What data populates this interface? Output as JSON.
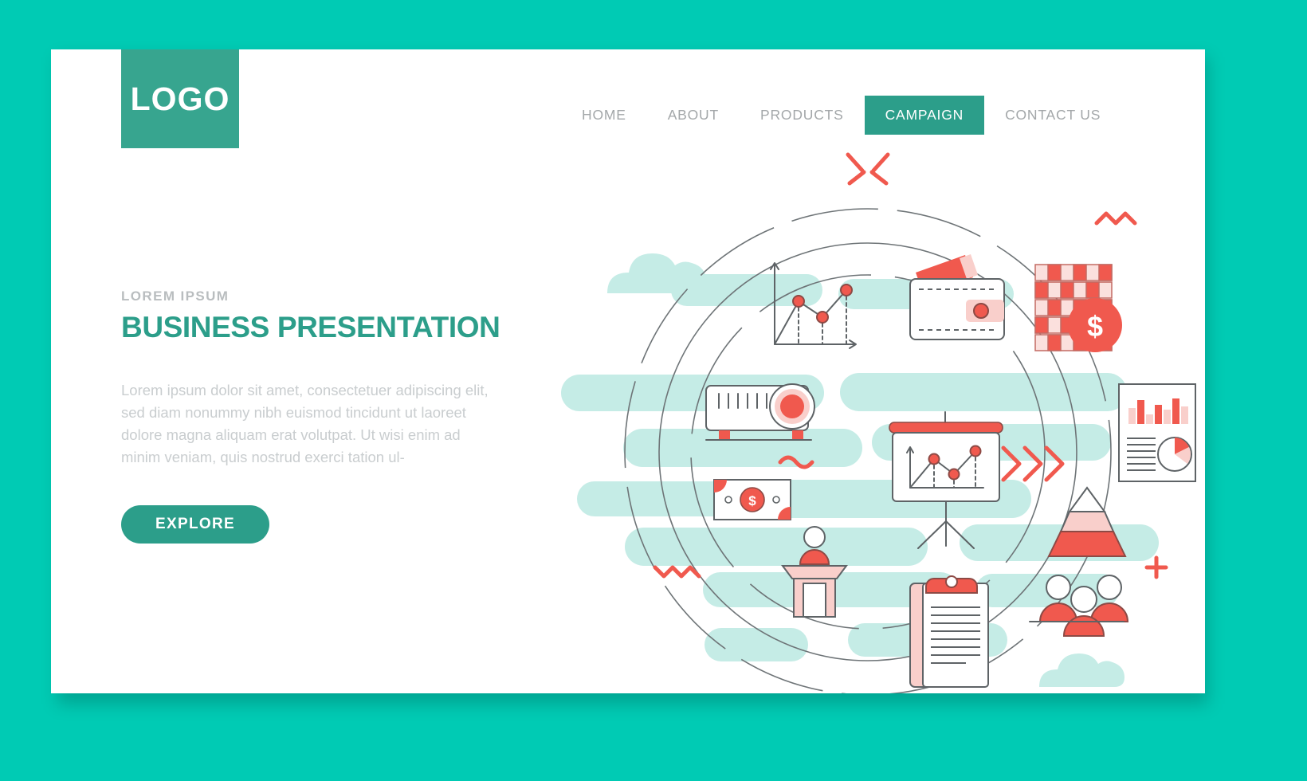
{
  "theme": {
    "page_bg": "#00cbb4",
    "card_bg": "#ffffff",
    "brand_teal": "#2c9e8a",
    "logo_teal": "#37a58f",
    "accent_red": "#f0594e",
    "accent_red_light": "#f9cfcb",
    "mint": "#c5ece6",
    "muted_text": "#a3a7a9",
    "body_text": "#c9cdcf",
    "outline": "#5e6366"
  },
  "header": {
    "logo_label": "LOGO",
    "nav": [
      {
        "label": "HOME",
        "active": false
      },
      {
        "label": "ABOUT",
        "active": false
      },
      {
        "label": "PRODUCTS",
        "active": false
      },
      {
        "label": "CAMPAIGN",
        "active": true
      },
      {
        "label": "CONTACT US",
        "active": false
      }
    ]
  },
  "hero": {
    "eyebrow": "LOREM IPSUM",
    "headline": "BUSINESS PRESENTATION",
    "body": "Lorem ipsum dolor sit amet, consectetuer adipiscing elit, sed diam nonummy nibh euismod tincidunt ut laoreet dolore magna aliquam erat volutpat. Ut wisi enim ad minim veniam, quis nostrud exerci tation ul-",
    "cta_label": "EXPLORE"
  },
  "illustration": {
    "alt": "business presentation concept illustration with circle frame",
    "icons": [
      {
        "name": "line-chart-icon",
        "label": "growth line chart"
      },
      {
        "name": "wallet-icon",
        "label": "wallet with cash"
      },
      {
        "name": "money-stack-icon",
        "label": "money stack with dollar coin"
      },
      {
        "name": "projector-icon",
        "label": "video projector"
      },
      {
        "name": "banknote-icon",
        "label": "dollar banknote"
      },
      {
        "name": "presentation-board-icon",
        "label": "presentation board with chart"
      },
      {
        "name": "report-document-icon",
        "label": "report with bar and pie chart"
      },
      {
        "name": "podium-icon",
        "label": "speaker at podium"
      },
      {
        "name": "clipboard-icon",
        "label": "clipboard document"
      },
      {
        "name": "pyramid-chart-icon",
        "label": "pyramid chart"
      },
      {
        "name": "team-group-icon",
        "label": "group of people"
      },
      {
        "name": "cloud-shape",
        "label": "decorative cloud"
      },
      {
        "name": "chevrons-icon",
        "label": "triple chevron arrows"
      },
      {
        "name": "zigzag-icon",
        "label": "zigzag accent line"
      },
      {
        "name": "plus-icon",
        "label": "plus accent mark"
      },
      {
        "name": "spark-icon",
        "label": "spark accent mark"
      },
      {
        "name": "squiggle-icon",
        "label": "wave accent line"
      }
    ]
  }
}
